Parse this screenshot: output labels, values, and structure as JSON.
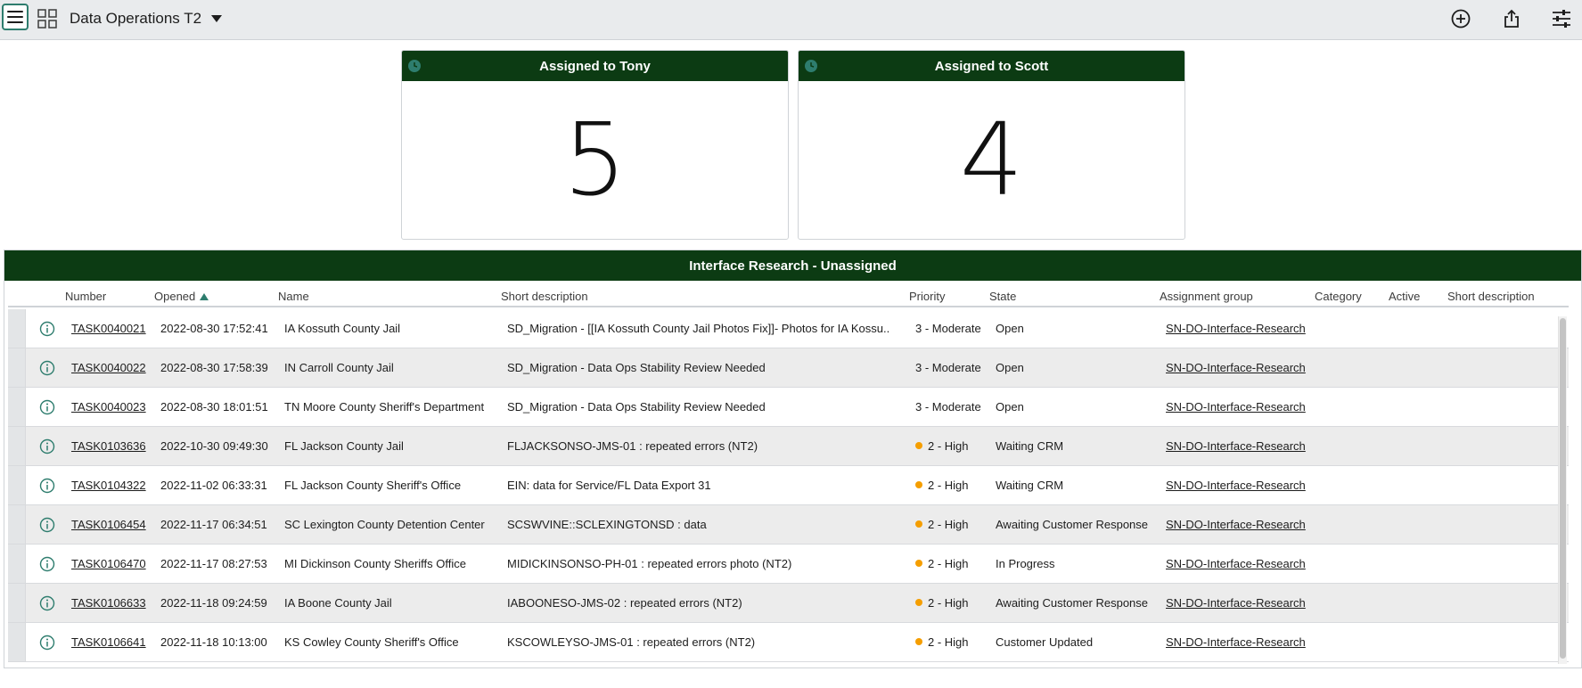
{
  "topbar": {
    "title": "Data Operations T2"
  },
  "scores": [
    {
      "title": "Assigned to Tony",
      "value": "5"
    },
    {
      "title": "Assigned to Scott",
      "value": "4"
    }
  ],
  "list": {
    "title": "Interface Research - Unassigned",
    "columns": {
      "number": "Number",
      "opened": "Opened",
      "name": "Name",
      "short_description": "Short description",
      "priority": "Priority",
      "state": "State",
      "assignment_group": "Assignment group",
      "category": "Category",
      "active": "Active",
      "short_description_2": "Short description"
    },
    "rows": [
      {
        "number": "TASK0040021",
        "opened": "2022-08-30 17:52:41",
        "name": "IA Kossuth County Jail",
        "desc": "SD_Migration - [[IA Kossuth County Jail Photos Fix]]- Photos for IA Kossu..",
        "priority": "3 - Moderate",
        "state": "Open",
        "group": "SN-DO-Interface-Research"
      },
      {
        "number": "TASK0040022",
        "opened": "2022-08-30 17:58:39",
        "name": "IN Carroll County Jail",
        "desc": "SD_Migration - Data Ops Stability Review Needed",
        "priority": "3 - Moderate",
        "state": "Open",
        "group": "SN-DO-Interface-Research"
      },
      {
        "number": "TASK0040023",
        "opened": "2022-08-30 18:01:51",
        "name": "TN Moore County Sheriff's Department",
        "desc": "SD_Migration - Data Ops Stability Review Needed",
        "priority": "3 - Moderate",
        "state": "Open",
        "group": "SN-DO-Interface-Research"
      },
      {
        "number": "TASK0103636",
        "opened": "2022-10-30 09:49:30",
        "name": "FL Jackson County Jail",
        "desc": "FLJACKSONSO-JMS-01 : repeated errors (NT2)",
        "priority": "2 - High",
        "state": "Waiting CRM",
        "group": "SN-DO-Interface-Research"
      },
      {
        "number": "TASK0104322",
        "opened": "2022-11-02 06:33:31",
        "name": "FL Jackson County Sheriff's Office",
        "desc": "EIN: data for Service/FL Data Export 31",
        "priority": "2 - High",
        "state": "Waiting CRM",
        "group": "SN-DO-Interface-Research"
      },
      {
        "number": "TASK0106454",
        "opened": "2022-11-17 06:34:51",
        "name": "SC Lexington County Detention Center",
        "desc": "SCSWVINE::SCLEXINGTONSD : data",
        "priority": "2 - High",
        "state": "Awaiting Customer Response",
        "group": "SN-DO-Interface-Research"
      },
      {
        "number": "TASK0106470",
        "opened": "2022-11-17 08:27:53",
        "name": "MI Dickinson County Sheriffs Office",
        "desc": "MIDICKINSONSO-PH-01 : repeated errors photo (NT2)",
        "priority": "2 - High",
        "state": "In Progress",
        "group": "SN-DO-Interface-Research"
      },
      {
        "number": "TASK0106633",
        "opened": "2022-11-18 09:24:59",
        "name": "IA Boone County Jail",
        "desc": "IABOONESO-JMS-02 : repeated errors (NT2)",
        "priority": "2 - High",
        "state": "Awaiting Customer Response",
        "group": "SN-DO-Interface-Research"
      },
      {
        "number": "TASK0106641",
        "opened": "2022-11-18 10:13:00",
        "name": "KS Cowley County Sheriff's Office",
        "desc": "KSCOWLEYSO-JMS-01 : repeated errors (NT2)",
        "priority": "2 - High",
        "state": "Customer Updated",
        "group": "SN-DO-Interface-Research"
      }
    ]
  },
  "colors": {
    "header_green": "#0c3b13",
    "accent_teal": "#2e7d6e",
    "priority_high_dot": "#f59e00"
  },
  "icons": {
    "menu": "hamburger-menu-icon",
    "grid": "grid-icon",
    "caret": "caret-down-icon",
    "add": "plus-circle-icon",
    "share": "share-icon",
    "settings": "sliders-icon",
    "clock": "clock-icon",
    "info": "info-circle-icon"
  }
}
